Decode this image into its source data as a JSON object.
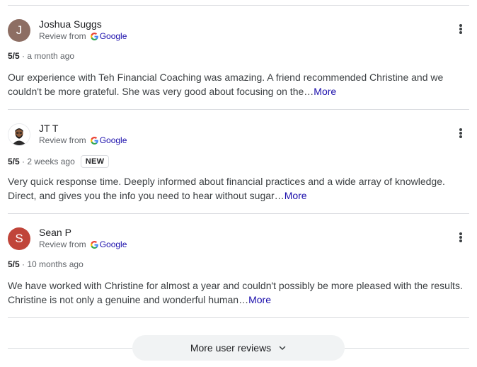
{
  "reviews": [
    {
      "name": "Joshua Suggs",
      "avatar_initial": "J",
      "avatar_color": "#8d6e63",
      "review_from": "Review from",
      "source": "Google",
      "rating": "5/5",
      "time": "a month ago",
      "text": "Our experience with Teh Financial Coaching was amazing. A friend recommended Christine and we couldn't be more grateful. She was very good about focusing on the…",
      "more_label": "More"
    },
    {
      "name": "JT T",
      "avatar_initial": "",
      "avatar_color": "#ffffff",
      "review_from": "Review from",
      "source": "Google",
      "rating": "5/5",
      "time": "2 weeks ago",
      "badge": "NEW",
      "text": "Very quick response time. Deeply informed about financial practices and a wide array of knowledge. Direct, and gives you the info you need to hear without sugar…",
      "more_label": "More"
    },
    {
      "name": "Sean P",
      "avatar_initial": "S",
      "avatar_color": "#c0453a",
      "review_from": "Review from",
      "source": "Google",
      "rating": "5/5",
      "time": "10 months ago",
      "text": "We have worked with Christine for almost a year and couldn't possibly be more pleased with the results. Christine is not only a genuine and wonderful human…",
      "more_label": "More"
    }
  ],
  "more_reviews_button": "More user reviews",
  "icons": {
    "menu": "more-vert-icon",
    "google": "google-g-icon",
    "chevron": "chevron-down-icon"
  }
}
